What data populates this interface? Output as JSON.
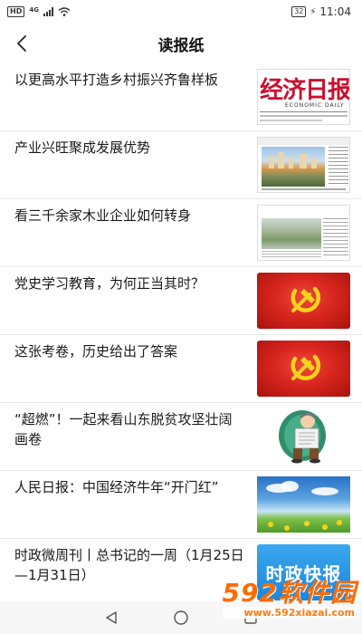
{
  "status_bar": {
    "network_badge": "HD",
    "network_type": "4G",
    "battery": "32",
    "time": "11:04"
  },
  "nav": {
    "title": "读报纸",
    "back_icon": "chevron-left-icon"
  },
  "newspaper_thumb": {
    "masthead": "经济日报",
    "subtitle": "ECONOMIC DAILY"
  },
  "news": [
    {
      "title": "以更高水平打造乡村振兴齐鲁样板",
      "thumb": "newspaper-front-page"
    },
    {
      "title": "产业兴旺聚成发展优势",
      "thumb": "city-skyline-newspaper"
    },
    {
      "title": "看三千余家木业企业如何转身",
      "thumb": "river-newspaper"
    },
    {
      "title": "党史学习教育，为何正当其时？",
      "thumb": "party-emblem"
    },
    {
      "title": "这张考卷，历史给出了答案",
      "thumb": "party-emblem"
    },
    {
      "title": "“超燃”！一起来看山东脱贫攻坚壮阔画卷",
      "thumb": "reading-cartoon"
    },
    {
      "title": "人民日报：中国经济牛年“开门红”",
      "thumb": "sky-meadow"
    },
    {
      "title": "时政微周刊丨总书记的一周（1月25日—1月31日）",
      "thumb": "politics-brief",
      "thumb_text": "时政快报"
    }
  ],
  "watermark": {
    "brand": "592软件园",
    "url": "www.592xiazai.com"
  },
  "colors": {
    "party_red": "#d8261e",
    "brand_orange": "#ff6a00",
    "brief_blue": "#1c86dc"
  }
}
